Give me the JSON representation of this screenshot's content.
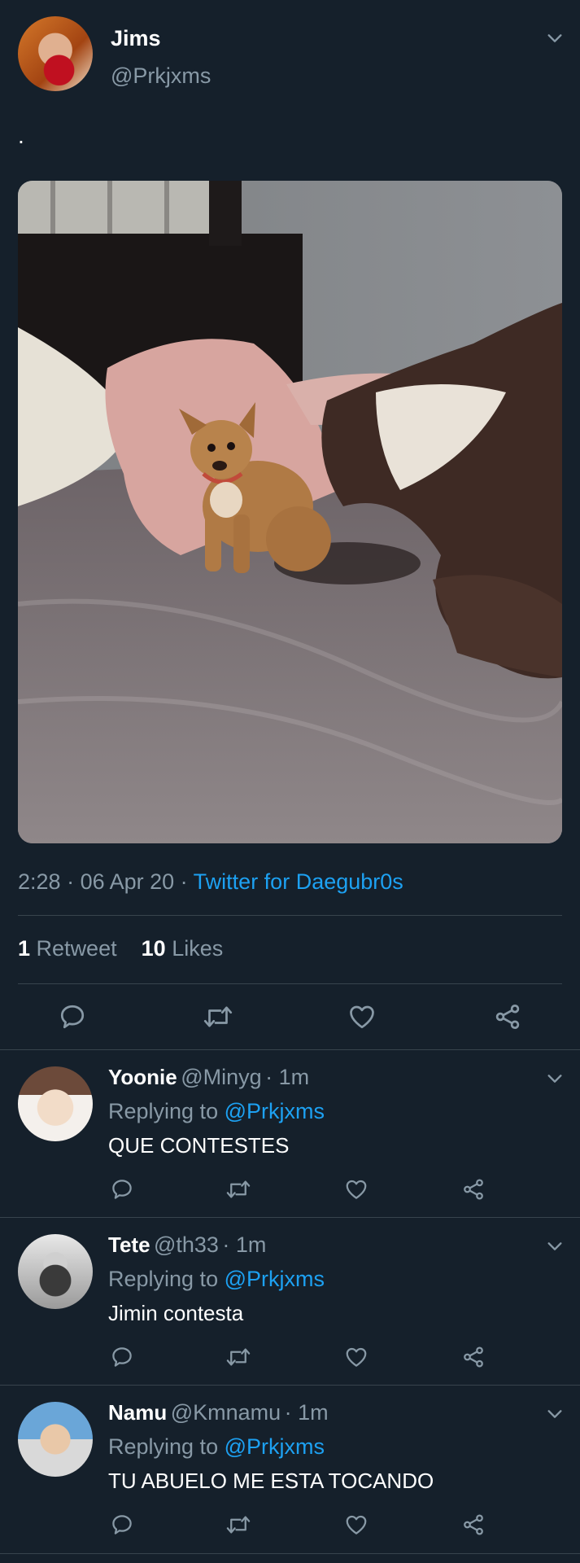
{
  "tweet": {
    "author_name": "Jims",
    "author_handle": "@Prkjxms",
    "text": ".",
    "time": "2:28",
    "date": "06 Apr 20",
    "source": "Twitter for Daegubr0s",
    "retweets_count": "1",
    "retweets_label": "Retweet",
    "likes_count": "10",
    "likes_label": "Likes"
  },
  "replies": [
    {
      "name": "Yoonie",
      "handle": "@Minyg",
      "time": "1m",
      "replying_prefix": "Replying to",
      "replying_to": "@Prkjxms",
      "text": "QUE CONTESTES"
    },
    {
      "name": "Tete",
      "handle": "@th33",
      "time": "1m",
      "replying_prefix": "Replying to",
      "replying_to": "@Prkjxms",
      "text": "Jimin contesta"
    },
    {
      "name": "Namu",
      "handle": "@Kmnamu",
      "time": "1m",
      "replying_prefix": "Replying to",
      "replying_to": "@Prkjxms",
      "text": "TU ABUELO ME ESTA TOCANDO"
    }
  ],
  "icons": {
    "reply": "reply-icon",
    "retweet": "retweet-icon",
    "like": "heart-icon",
    "share": "share-icon",
    "more": "chevron-down-icon"
  },
  "colors": {
    "background": "#15202b",
    "text": "#ffffff",
    "muted": "#8899a6",
    "link": "#1da1f2",
    "divider": "#38444d"
  }
}
